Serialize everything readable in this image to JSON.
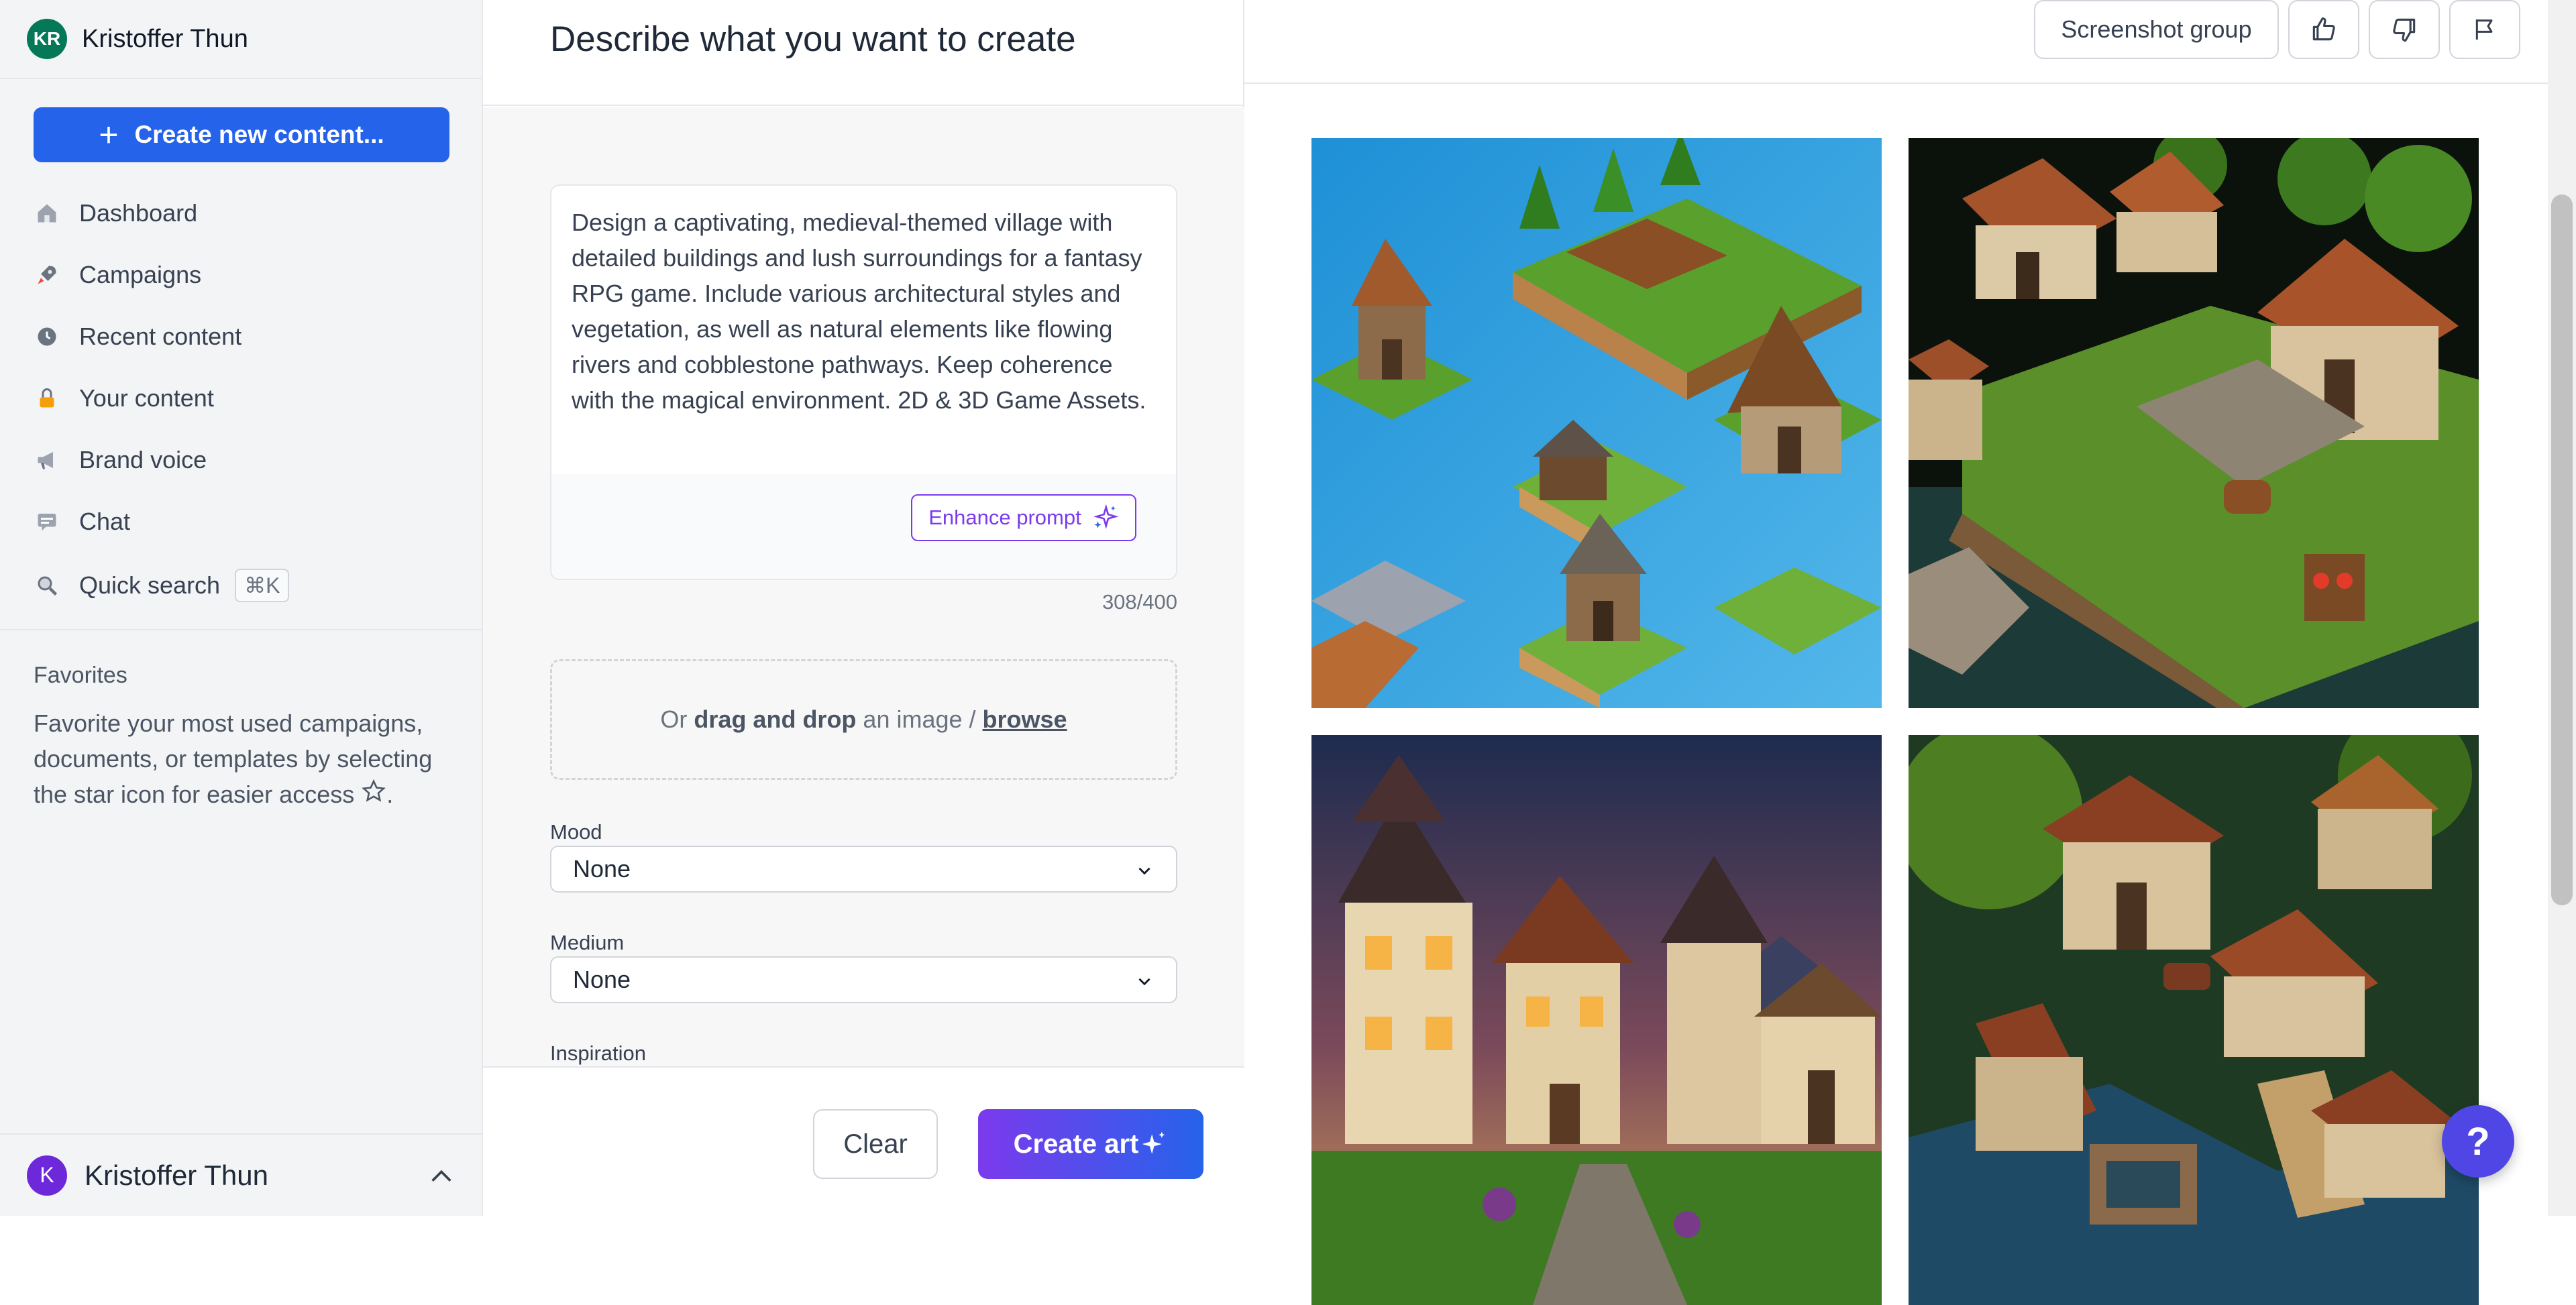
{
  "workspace": {
    "initials": "KR",
    "name": "Kristoffer Thun"
  },
  "sidebar": {
    "create_label": "Create new content...",
    "items": [
      {
        "label": "Dashboard",
        "icon": "home-icon"
      },
      {
        "label": "Campaigns",
        "icon": "rocket-icon"
      },
      {
        "label": "Recent content",
        "icon": "clock-icon"
      },
      {
        "label": "Your content",
        "icon": "lock-icon"
      },
      {
        "label": "Brand voice",
        "icon": "megaphone-icon"
      },
      {
        "label": "Chat",
        "icon": "chat-icon"
      },
      {
        "label": "Quick search",
        "icon": "search-icon",
        "shortcut": "⌘K"
      }
    ],
    "favorites": {
      "title": "Favorites",
      "text_before": "Favorite your most used campaigns, documents, or templates by selecting the star icon for easier access",
      "text_after": "."
    },
    "user": {
      "initial": "K",
      "name": "Kristoffer Thun"
    }
  },
  "main": {
    "title": "Describe what you want to create",
    "prompt": "Design a captivating, medieval-themed village with detailed buildings and lush surroundings for a fantasy RPG game. Include various architectural styles and vegetation, as well as natural elements like flowing rivers and cobblestone pathways. Keep coherence with the magical environment. 2D & 3D Game Assets.",
    "enhance_label": "Enhance prompt",
    "char_count": "308/400",
    "dropzone": {
      "prefix": "Or",
      "bold": "drag and drop",
      "middle": "an image /",
      "link": "browse"
    },
    "mood": {
      "label": "Mood",
      "value": "None"
    },
    "medium": {
      "label": "Medium",
      "value": "None"
    },
    "inspiration": {
      "label": "Inspiration"
    },
    "clear_label": "Clear",
    "create_label": "Create art"
  },
  "results": {
    "group_label": "Screenshot group",
    "images": [
      {
        "name": "isometric-village-islands"
      },
      {
        "name": "village-cliff-river-dark"
      },
      {
        "name": "village-houses-dusk"
      },
      {
        "name": "village-bridge-river"
      }
    ]
  },
  "help": {
    "label": "?"
  },
  "colors": {
    "primary": "#2563eb",
    "accent": "#7c3aed",
    "sidebar_bg": "#f3f4f6"
  }
}
